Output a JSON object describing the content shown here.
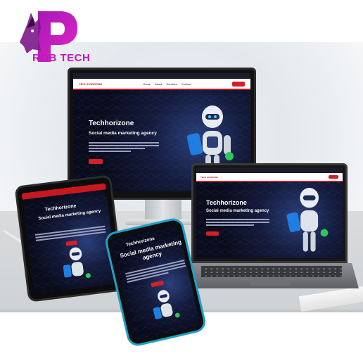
{
  "brand": {
    "logo_text": "ROB  TECH",
    "accent": "#c21ab8"
  },
  "website": {
    "title": "Techhorizone",
    "subtitle": "Social media marketing agency",
    "nav_items": [
      "Home",
      "About",
      "Services",
      "Contact"
    ],
    "logo_text": "TECH HORIZONE",
    "accent": "#d32027",
    "dark_bg": "#0b0d1e"
  }
}
